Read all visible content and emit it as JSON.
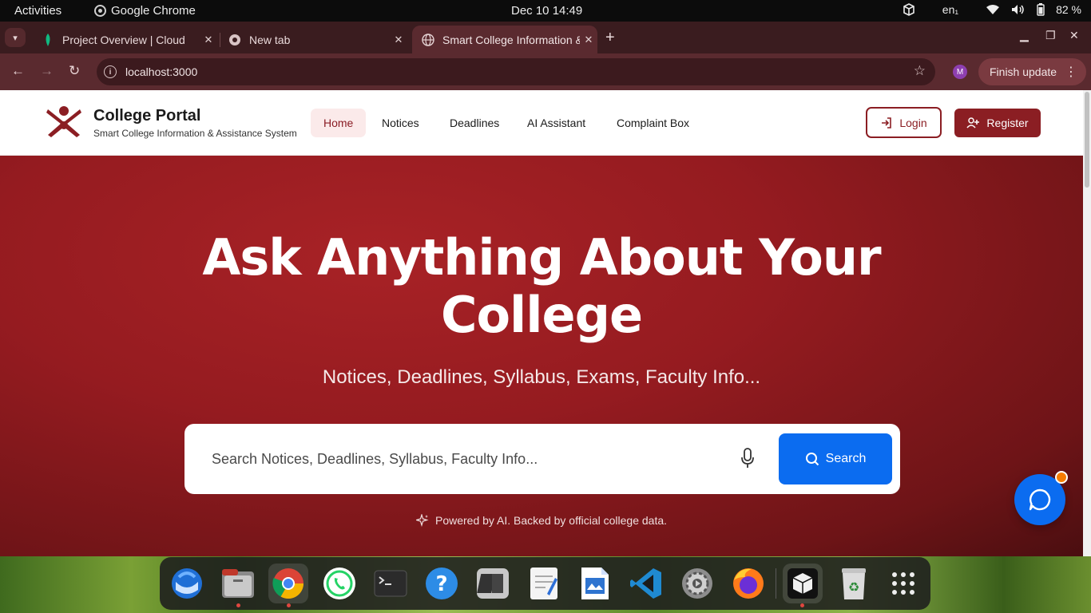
{
  "system": {
    "activities": "Activities",
    "app_name": "Google Chrome",
    "clock": "Dec 10  14:49",
    "keyboard_layout": "en₁",
    "battery": "82 %"
  },
  "browser": {
    "tabs": [
      {
        "title": "Project Overview | Cloud",
        "active": false
      },
      {
        "title": "New tab",
        "active": false
      },
      {
        "title": "Smart College Information & Assistance System",
        "active": true
      }
    ],
    "url": "localhost:3000",
    "profile_initial": "M",
    "finish_update": "Finish update"
  },
  "site": {
    "brand_title": "College Portal",
    "brand_subtitle": "Smart College Information & Assistance System",
    "nav": [
      {
        "label": "Home",
        "active": true
      },
      {
        "label": "Notices"
      },
      {
        "label": "Deadlines"
      },
      {
        "label": "AI Assistant"
      },
      {
        "label": "Complaint Box"
      }
    ],
    "login_label": "Login",
    "register_label": "Register",
    "hero": {
      "title_line1": "Ask Anything About Your",
      "title_line2": "College",
      "subtitle": "Notices, Deadlines, Syllabus, Exams, Faculty Info...",
      "search_placeholder": "Search Notices, Deadlines, Syllabus, Faculty Info...",
      "search_button": "Search",
      "powered_by": "Powered by AI. Backed by official college data."
    }
  },
  "colors": {
    "brand": "#8b1e23",
    "accent_blue": "#0b6cf0",
    "chrome_frame": "#3a1c1f",
    "chrome_toolbar": "#5a2a2f",
    "notification": "#f57c00"
  },
  "dock": {
    "items": [
      "thunderbird-icon",
      "files-icon",
      "chrome-icon",
      "whatsapp-icon",
      "terminal-icon",
      "help-icon",
      "remmina-icon",
      "text-editor-icon",
      "writer-icon",
      "vscode-icon",
      "settings-icon",
      "firefox-icon",
      "virtualbox-icon",
      "trash-icon",
      "app-grid-icon"
    ]
  }
}
